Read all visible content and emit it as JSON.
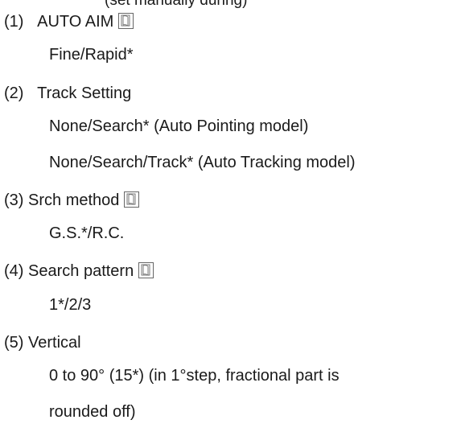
{
  "top_clipped_text": "(set manually during)",
  "items": [
    {
      "number": "(1)",
      "title": "AUTO AIM",
      "has_icon": true,
      "values": [
        "Fine/Rapid*"
      ]
    },
    {
      "number": "(2)",
      "title": "Track Setting",
      "has_icon": false,
      "values": [
        "None/Search* (Auto Pointing model)",
        "None/Search/Track* (Auto Tracking model)"
      ]
    },
    {
      "number": "(3)",
      "title": "Srch method",
      "has_icon": true,
      "values": [
        "G.S.*/R.C."
      ]
    },
    {
      "number": "(4)",
      "title": "Search pattern",
      "has_icon": true,
      "values": [
        "1*/2/3"
      ]
    },
    {
      "number": "(5)",
      "title": "Vertical",
      "has_icon": false,
      "values": [
        "0 to 90° (15*) (in 1°step, fractional part is",
        "rounded off)"
      ]
    }
  ],
  "icon_name": "manual-book-icon"
}
